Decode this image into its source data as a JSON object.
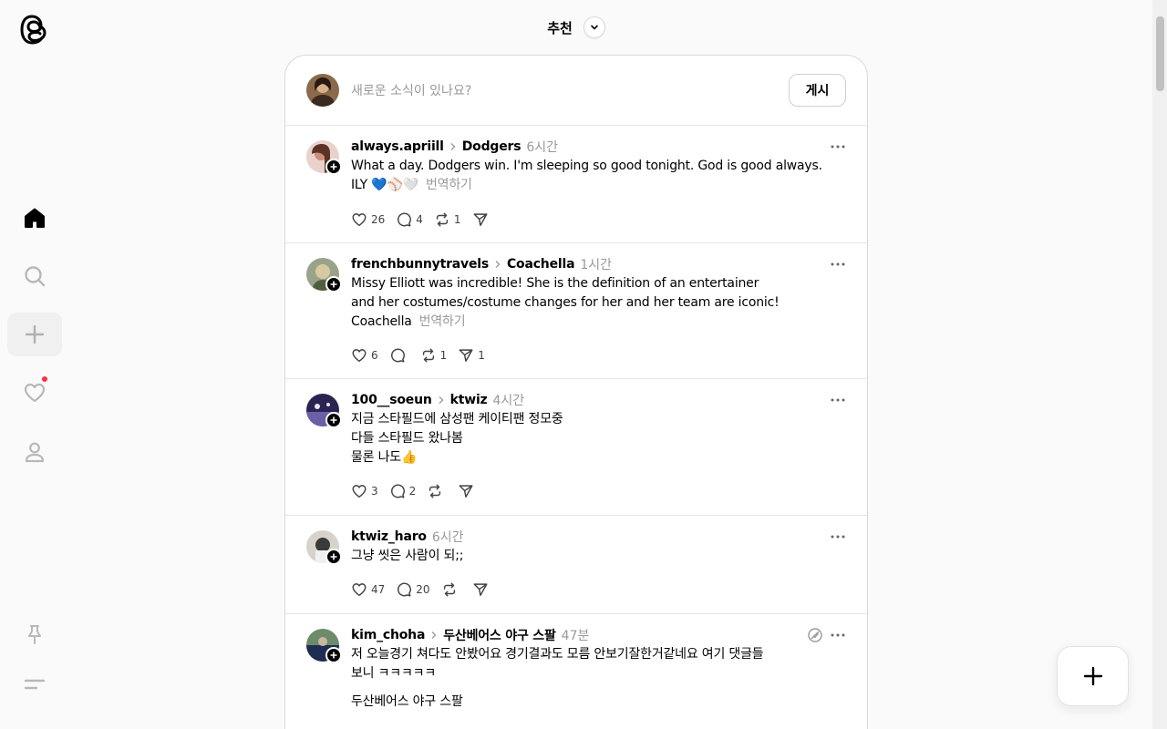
{
  "header": {
    "feed_title": "추천"
  },
  "composer": {
    "placeholder": "새로운 소식이 있나요?",
    "post_label": "게시"
  },
  "posts": [
    {
      "username": "always.apriill",
      "community": "Dodgers",
      "time": "6시간",
      "lines": [
        "What a day. Dodgers win. I'm sleeping so good tonight. God is good always.",
        "ILY 💙⚾🤍"
      ],
      "translate": "번역하기",
      "likes": "26",
      "comments": "4",
      "reposts": "1",
      "shares": ""
    },
    {
      "username": "frenchbunnytravels",
      "community": "Coachella",
      "time": "1시간",
      "lines": [
        "Missy Elliott was incredible! She is the definition of an entertainer",
        "and her costumes/costume changes for her and her team are iconic!",
        "Coachella"
      ],
      "translate": "번역하기",
      "likes": "6",
      "comments": "",
      "reposts": "1",
      "shares": "1"
    },
    {
      "username": "100__soeun",
      "community": "ktwiz",
      "time": "4시간",
      "lines": [
        "지금 스타필드에 삼성팬 케이티팬 정모중",
        "다들 스타필드 왔나봄",
        "물론 나도👍"
      ],
      "translate": "",
      "likes": "3",
      "comments": "2",
      "reposts": "",
      "shares": ""
    },
    {
      "username": "ktwiz_haro",
      "community": "",
      "time": "6시간",
      "lines": [
        "그냥 씻은 사람이 되;;"
      ],
      "translate": "",
      "likes": "47",
      "comments": "20",
      "reposts": "",
      "shares": ""
    },
    {
      "username": "kim_choha",
      "community": "두산베어스 야구 스팔",
      "time": "47분",
      "lines": [
        "저 오늘경기 쳐다도 안봤어요 경기결과도 모름 안보기잘한거같네요 여기 댓글들",
        "보니 ㅋㅋㅋㅋㅋ"
      ],
      "extra": "두산베어스 야구 스팔",
      "translate": "",
      "likes": "",
      "comments": "",
      "reposts": "",
      "shares": ""
    }
  ],
  "colors": {
    "notification_dot": "#ff3040",
    "secondary_text": "#999999"
  },
  "icons": [
    "threads-logo-icon",
    "home-icon",
    "search-icon",
    "create-icon",
    "heart-icon",
    "profile-icon",
    "pin-icon",
    "menu-icon",
    "chevron-down-icon"
  ]
}
